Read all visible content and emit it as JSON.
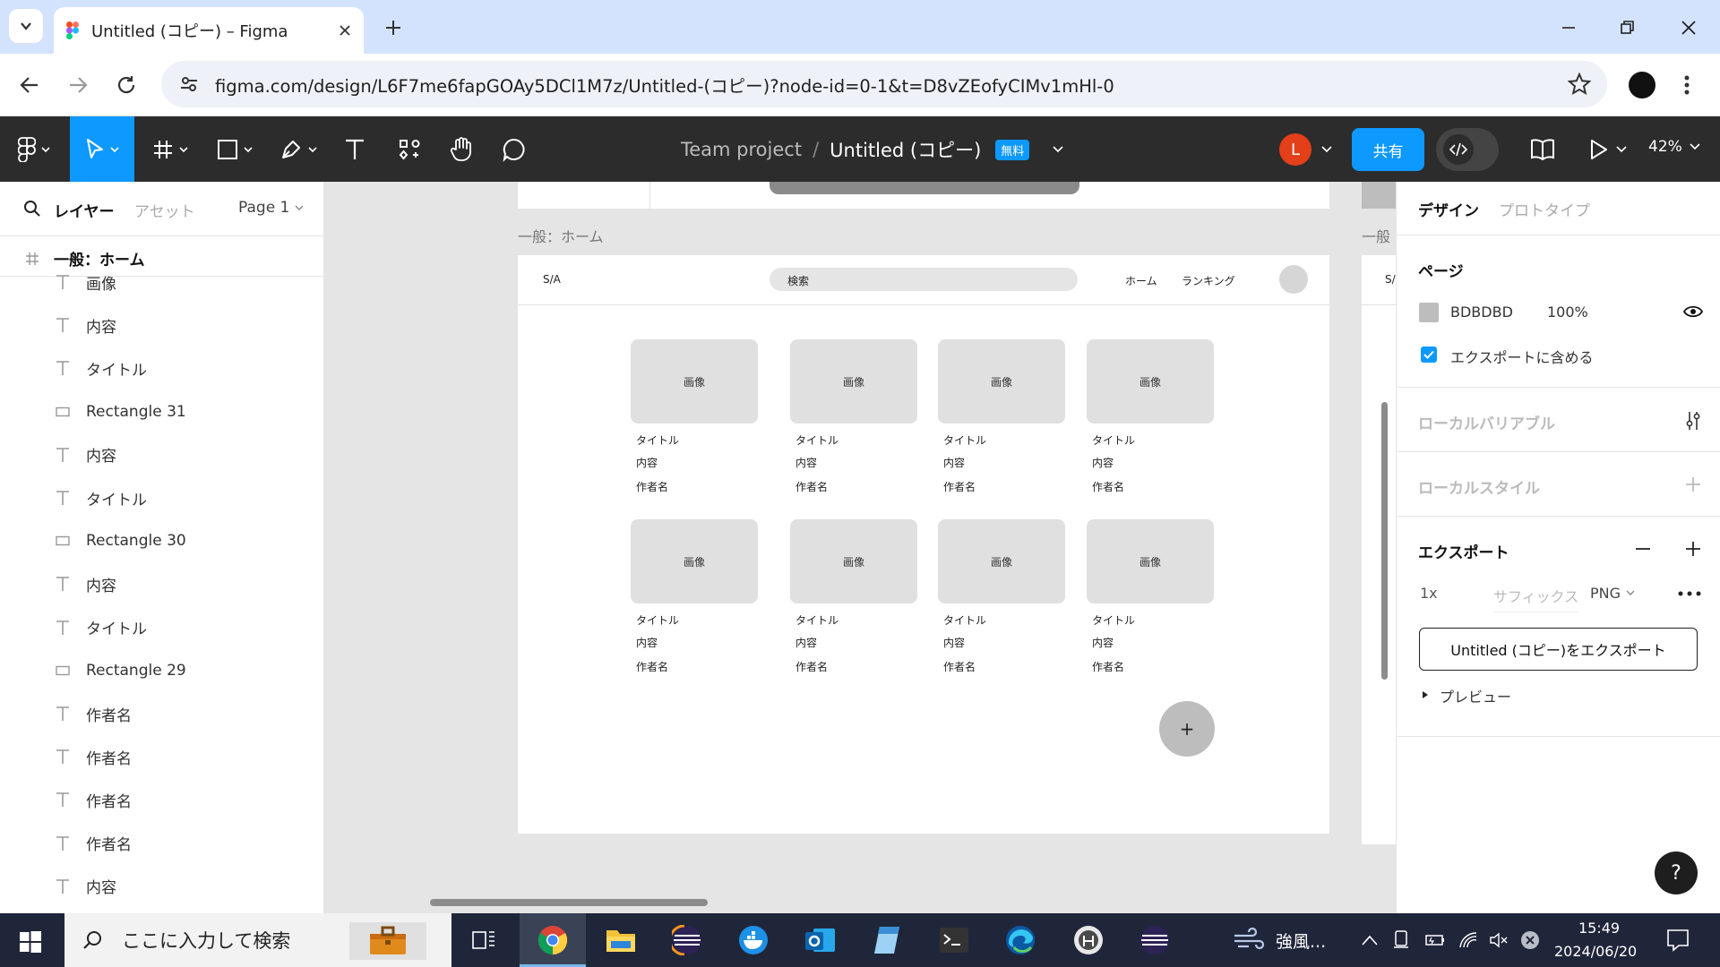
{
  "browser": {
    "tab_title": "Untitled (コピー) – Figma",
    "url": "figma.com/design/L6F7me6fapGOAy5DCl1M7z/Untitled-(コピー)?node-id=0-1&t=D8vZEofyCIMv1mHl-0"
  },
  "figma_toolbar": {
    "team": "Team project",
    "separator": "/",
    "file_name": "Untitled (コピー)",
    "badge": "無料",
    "avatar_initial": "L",
    "share_label": "共有",
    "zoom": "42%"
  },
  "left_panel": {
    "tab_layers": "レイヤー",
    "tab_assets": "アセット",
    "page_selector": "Page 1",
    "frame_name": "一般：ホーム",
    "layers": [
      {
        "type": "text",
        "name": "画像"
      },
      {
        "type": "text",
        "name": "内容"
      },
      {
        "type": "text",
        "name": "タイトル"
      },
      {
        "type": "rect",
        "name": "Rectangle 31"
      },
      {
        "type": "text",
        "name": "内容"
      },
      {
        "type": "text",
        "name": "タイトル"
      },
      {
        "type": "rect",
        "name": "Rectangle 30"
      },
      {
        "type": "text",
        "name": "内容"
      },
      {
        "type": "text",
        "name": "タイトル"
      },
      {
        "type": "rect",
        "name": "Rectangle 29"
      },
      {
        "type": "text",
        "name": "作者名"
      },
      {
        "type": "text",
        "name": "作者名"
      },
      {
        "type": "text",
        "name": "作者名"
      },
      {
        "type": "text",
        "name": "作者名"
      },
      {
        "type": "text",
        "name": "内容"
      }
    ]
  },
  "canvas": {
    "frame_label": "一般：ホーム",
    "frame_label_right": "一般",
    "nav_logo": "S/A",
    "nav_logo_right": "S/",
    "search_placeholder": "検索",
    "nav_home": "ホーム",
    "nav_ranking": "ランキング",
    "fab_label": "+",
    "card_image": "画像",
    "card_title": "タイトル",
    "card_content": "内容",
    "card_author": "作者名"
  },
  "right_panel": {
    "tab_design": "デザイン",
    "tab_prototype": "プロトタイプ",
    "page_heading": "ページ",
    "page_color": "BDBDBD",
    "page_opacity": "100%",
    "include_export": "エクスポートに含める",
    "local_variables": "ローカルバリアブル",
    "local_styles": "ローカルスタイル",
    "export_heading": "エクスポート",
    "export_scale": "1x",
    "export_suffix_placeholder": "サフィックス",
    "export_format": "PNG",
    "export_button": "Untitled (コピー)をエクスポート",
    "preview": "プレビュー",
    "help": "?"
  },
  "taskbar": {
    "search_placeholder": "ここに入力して検索",
    "weather": "強風...",
    "time": "15:49",
    "date": "2024/06/20"
  },
  "colors": {
    "figma_blue": "#0d99ff",
    "toolbar_bg": "#2c2c2c",
    "canvas_bg": "#e5e5e5",
    "page_swatch": "#bdbdbd"
  }
}
